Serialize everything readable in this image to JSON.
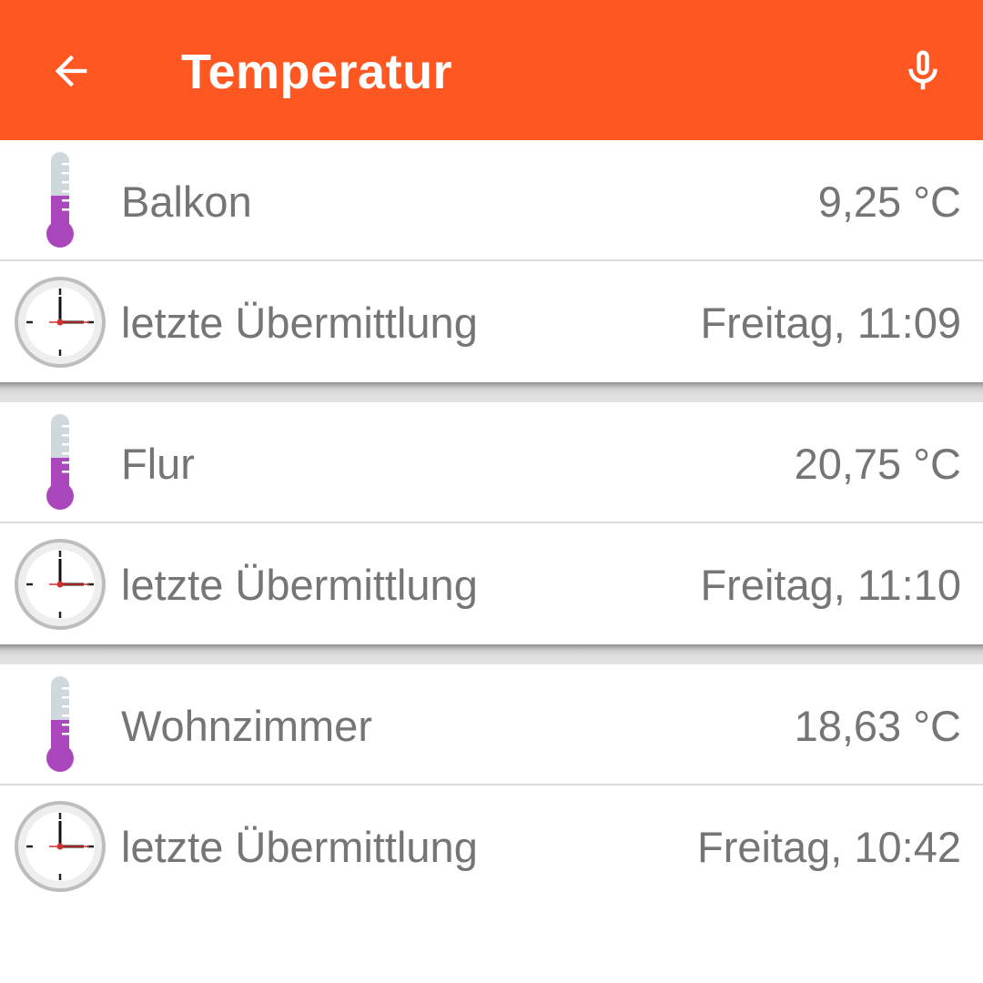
{
  "appbar": {
    "title": "Temperatur",
    "back_icon": "arrow-back-icon",
    "mic_icon": "microphone-icon",
    "color": "#ff5722"
  },
  "sensors": [
    {
      "name": "Balkon",
      "temperature": "9,25 °C",
      "last_label": "letzte Übermittlung",
      "last_time": "Freitag, 11:09"
    },
    {
      "name": "Flur",
      "temperature": "20,75 °C",
      "last_label": "letzte Übermittlung",
      "last_time": "Freitag, 11:10"
    },
    {
      "name": "Wohnzimmer",
      "temperature": "18,63 °C",
      "last_label": "letzte Übermittlung",
      "last_time": "Freitag, 10:42"
    }
  ],
  "icons": {
    "thermometer": "thermometer-icon",
    "clock": "clock-icon"
  },
  "colors": {
    "thermometer_fill": "#ab47bc",
    "text": "#757575"
  }
}
